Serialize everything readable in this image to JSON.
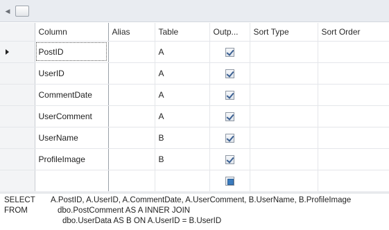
{
  "grid": {
    "columns": [
      "Column",
      "Alias",
      "Table",
      "Outp...",
      "Sort Type",
      "Sort Order"
    ],
    "rows": [
      {
        "column": "PostID",
        "alias": "",
        "table": "A",
        "output": "checked",
        "sort_type": "",
        "sort_order": ""
      },
      {
        "column": "UserID",
        "alias": "",
        "table": "A",
        "output": "checked",
        "sort_type": "",
        "sort_order": ""
      },
      {
        "column": "CommentDate",
        "alias": "",
        "table": "A",
        "output": "checked",
        "sort_type": "",
        "sort_order": ""
      },
      {
        "column": "UserComment",
        "alias": "",
        "table": "A",
        "output": "checked",
        "sort_type": "",
        "sort_order": ""
      },
      {
        "column": "UserName",
        "alias": "",
        "table": "B",
        "output": "checked",
        "sort_type": "",
        "sort_order": ""
      },
      {
        "column": "ProfileImage",
        "alias": "",
        "table": "B",
        "output": "checked",
        "sort_type": "",
        "sort_order": ""
      },
      {
        "column": "",
        "alias": "",
        "table": "",
        "output": "indeterminate",
        "sort_type": "",
        "sort_order": ""
      }
    ]
  },
  "sql": {
    "select_kw": "SELECT",
    "select_list": "A.PostID, A.UserID, A.CommentDate, A.UserComment, B.UserName, B.ProfileImage",
    "from_kw": "FROM",
    "from_line1": "dbo.PostComment AS A INNER JOIN",
    "from_line2": "dbo.UserData AS B ON A.UserID = B.UserID"
  },
  "colors": {
    "header_bg": "#f3f4f6",
    "grid_line": "#e4e6ea",
    "check": "#3a5f92"
  }
}
